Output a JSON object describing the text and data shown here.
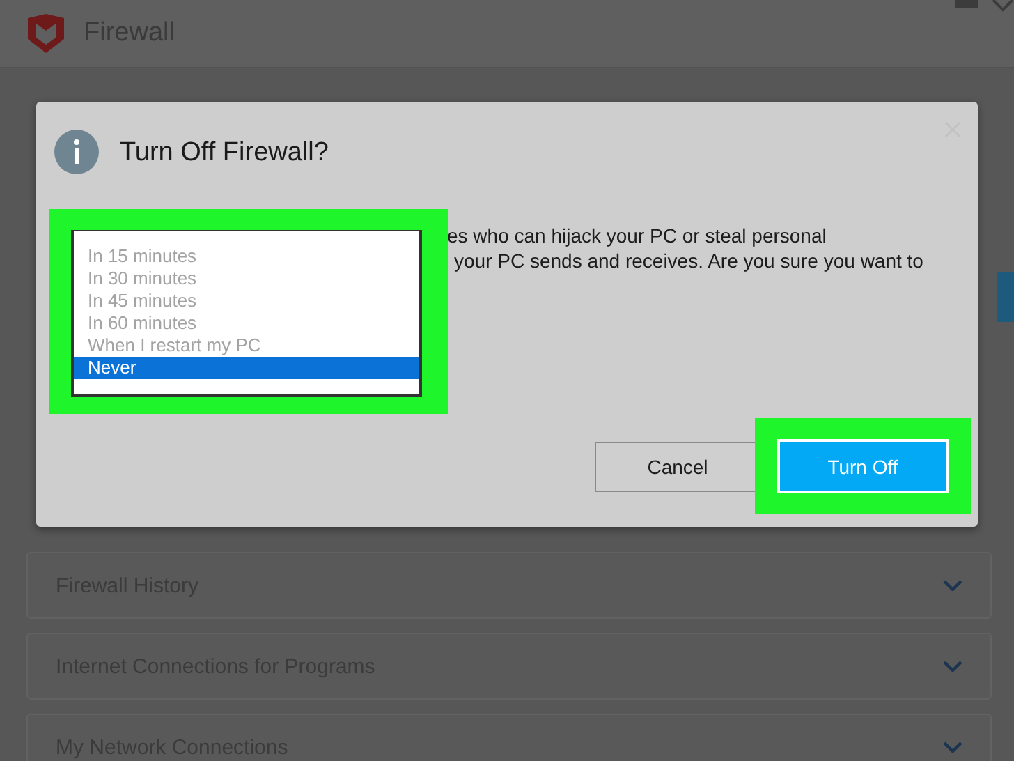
{
  "app": {
    "title": "Firewall",
    "sections": [
      {
        "label": "Firewall History"
      },
      {
        "label": "Internet Connections for Programs"
      },
      {
        "label": "My Network Connections"
      }
    ]
  },
  "dialog": {
    "title": "Turn Off Firewall?",
    "message_lines": [
      "es who can hijack your PC or steal personal",
      "your PC sends and receives. Are you sure you want to"
    ],
    "dropdown": {
      "highlighted": true,
      "options": [
        {
          "label": "In 15 minutes",
          "selected": false
        },
        {
          "label": "In 30 minutes",
          "selected": false
        },
        {
          "label": "In 45 minutes",
          "selected": false
        },
        {
          "label": "In 60 minutes",
          "selected": false
        },
        {
          "label": "When I restart my PC",
          "selected": false
        },
        {
          "label": "Never",
          "selected": true
        }
      ]
    },
    "buttons": [
      {
        "label": "Cancel",
        "kind": "secondary"
      },
      {
        "label": "Turn Off",
        "kind": "primary",
        "highlighted": true
      }
    ]
  }
}
